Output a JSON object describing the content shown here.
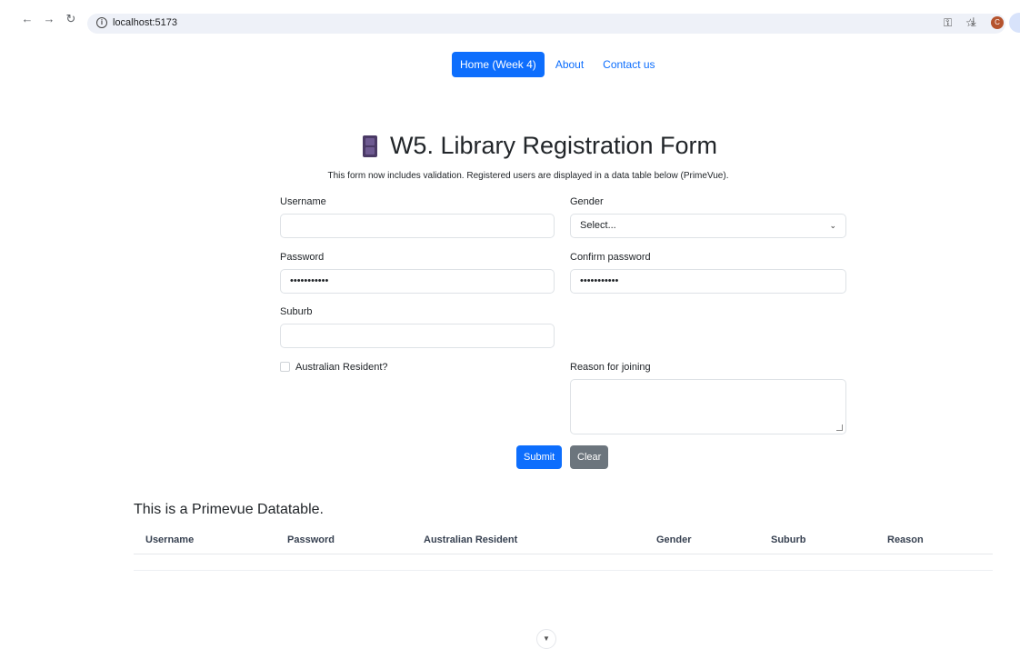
{
  "browser": {
    "url": "localhost:5173",
    "profile_initial": "C"
  },
  "nav": {
    "items": [
      "Home (Week 4)",
      "About",
      "Contact us"
    ],
    "active_index": 0
  },
  "page": {
    "title": "W5. Library Registration Form",
    "title_icon": "file-cabinet-icon",
    "subtitle": "This form now includes validation. Registered users are displayed in a data table below (PrimeVue)."
  },
  "form": {
    "username": {
      "label": "Username",
      "value": ""
    },
    "gender": {
      "label": "Gender",
      "value": "Select..."
    },
    "password": {
      "label": "Password",
      "value": "•••••••••••"
    },
    "confirm_password": {
      "label": "Confirm password",
      "value": "•••••••••••"
    },
    "suburb": {
      "label": "Suburb",
      "value": ""
    },
    "resident": {
      "label": "Australian Resident?",
      "checked": false
    },
    "reason": {
      "label": "Reason for joining",
      "value": ""
    },
    "submit_label": "Submit",
    "clear_label": "Clear"
  },
  "table": {
    "title": "This is a Primevue Datatable.",
    "columns": [
      "Username",
      "Password",
      "Australian Resident",
      "Gender",
      "Suburb",
      "Reason"
    ],
    "rows": []
  },
  "colors": {
    "primary": "#0d6efd",
    "secondary": "#6c757d"
  }
}
